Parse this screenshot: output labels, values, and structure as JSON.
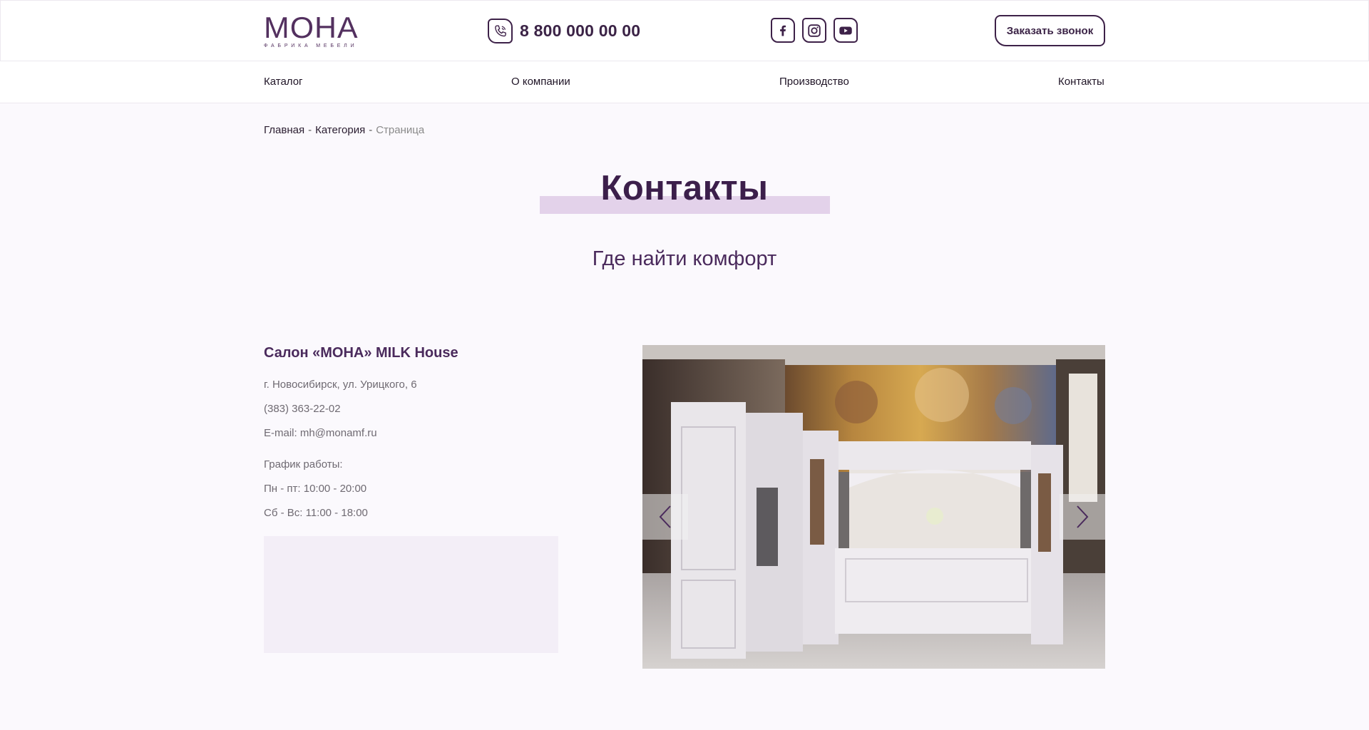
{
  "header": {
    "logo_title": "МОНА",
    "logo_subtitle": "ФАБРИКА МЕБЕЛИ",
    "phone": "8 800 000 00 00",
    "callback_button": "Заказать звонок",
    "socials": [
      "facebook-icon",
      "instagram-icon",
      "youtube-icon"
    ]
  },
  "nav": {
    "items": [
      "Каталог",
      "О компании",
      "Производство",
      "Контакты"
    ]
  },
  "breadcrumb": {
    "items": [
      "Главная",
      "Категория"
    ],
    "separator": "-",
    "current": "Страница"
  },
  "page": {
    "title": "Контакты",
    "subtitle": "Где найти комфорт"
  },
  "salon": {
    "name": "Салон «МОНА» MILK House",
    "address": "г. Новосибирск, ул. Урицкого, 6",
    "phone": "(383) 363-22-02",
    "email": "E-mail: mh@monamf.ru",
    "schedule_label": "График работы:",
    "schedule_weekdays": "Пн - пт: 10:00 - 20:00",
    "schedule_weekend": "Сб - Вс: 11:00 - 18:00"
  },
  "colors": {
    "brand": "#53305f",
    "accent_band": "#e3d2ea",
    "text_muted": "#6f6a72",
    "background": "#fbf9fd"
  }
}
